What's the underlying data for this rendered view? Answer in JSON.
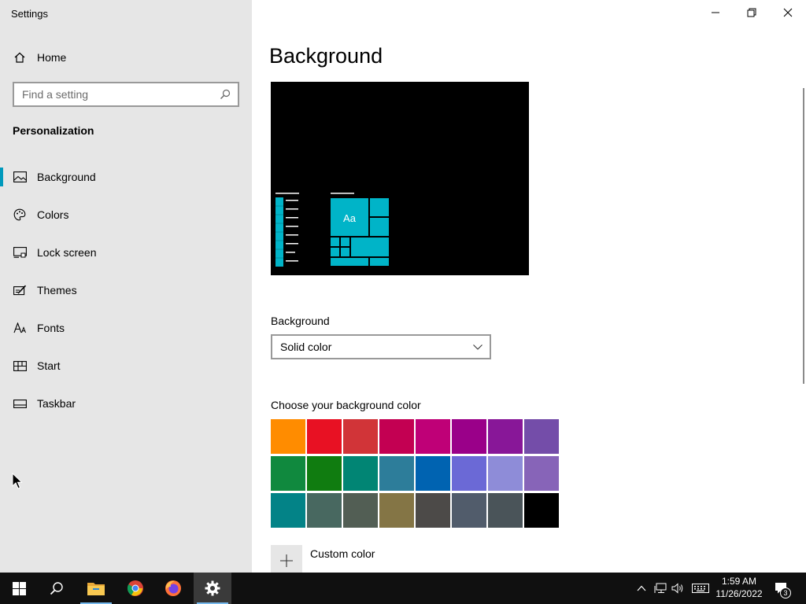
{
  "window": {
    "title": "Settings"
  },
  "nav": {
    "home_label": "Home",
    "search_placeholder": "Find a setting",
    "section_title": "Personalization",
    "items": [
      {
        "label": "Background",
        "icon": "picture-icon",
        "active": true
      },
      {
        "label": "Colors",
        "icon": "palette-icon",
        "active": false
      },
      {
        "label": "Lock screen",
        "icon": "lock-screen-icon",
        "active": false
      },
      {
        "label": "Themes",
        "icon": "themes-icon",
        "active": false
      },
      {
        "label": "Fonts",
        "icon": "fonts-icon",
        "active": false
      },
      {
        "label": "Start",
        "icon": "start-icon",
        "active": false
      },
      {
        "label": "Taskbar",
        "icon": "taskbar-icon",
        "active": false
      }
    ]
  },
  "main": {
    "title": "Background",
    "preview_tile_text": "Aa",
    "background_label": "Background",
    "background_value": "Solid color",
    "choose_color_label": "Choose your background color",
    "custom_color_label": "Custom color",
    "swatches": [
      "#ff8c00",
      "#e81123",
      "#d13438",
      "#c30052",
      "#bf0077",
      "#9a0089",
      "#881798",
      "#744da9",
      "#10893e",
      "#107c10",
      "#018574",
      "#2d7d9a",
      "#0063b1",
      "#6b69d6",
      "#8e8cd8",
      "#8764b8",
      "#038387",
      "#486860",
      "#525e54",
      "#847545",
      "#4c4a48",
      "#515c6b",
      "#4a5459",
      "#000000"
    ]
  },
  "colors": {
    "accent": "#0099bc",
    "nav_bg": "#e6e6e6",
    "taskbar_bg": "#101010"
  },
  "taskbar": {
    "apps": [
      "start-icon",
      "search-icon",
      "file-explorer-icon",
      "chrome-icon",
      "firefox-icon",
      "settings-icon"
    ],
    "time": "1:59 AM",
    "date": "11/26/2022",
    "notification_count": "3"
  }
}
